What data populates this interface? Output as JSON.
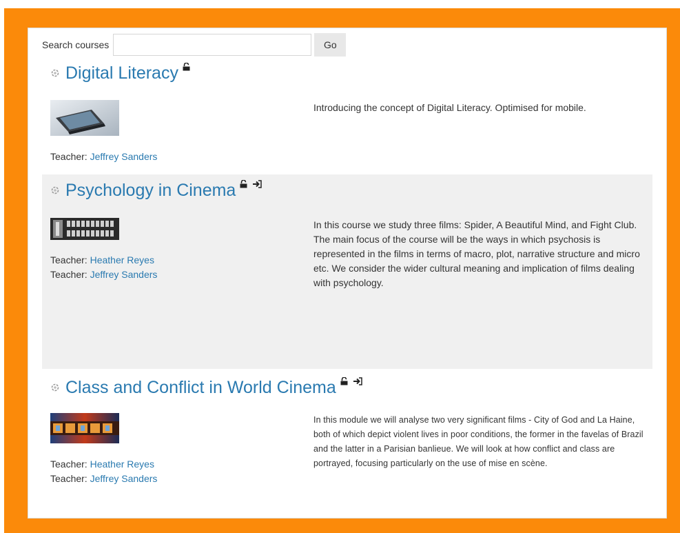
{
  "search": {
    "label": "Search courses",
    "value": "",
    "placeholder": "",
    "button_label": "Go"
  },
  "courses": [
    {
      "title": "Digital Literacy",
      "icons": [
        "lock-open-icon"
      ],
      "summary": "Introducing the concept of Digital Literacy. Optimised for mobile.",
      "teachers": [
        {
          "prefix": "Teacher:",
          "name": "Jeffrey Sanders"
        }
      ]
    },
    {
      "title": "Psychology in Cinema",
      "icons": [
        "lock-open-icon",
        "login-icon"
      ],
      "summary": "In this course we study three films: Spider, A Beautiful Mind, and Fight Club. The main focus of the course will be the ways in which psychosis is represented in the films in terms of macro, plot, narrative structure and micro etc. We consider the wider cultural meaning and implication of films dealing with psychology.",
      "teachers": [
        {
          "prefix": "Teacher:",
          "name": "Heather Reyes"
        },
        {
          "prefix": "Teacher:",
          "name": "Jeffrey Sanders"
        }
      ]
    },
    {
      "title": "Class and Conflict in World Cinema",
      "icons": [
        "lock-open-icon",
        "login-icon"
      ],
      "summary": "In this module we will analyse two very significant films - City of God and La Haine, both of which depict violent lives in poor conditions, the former in the favelas of Brazil and the latter in a Parisian banlieue. We will look at how conflict and class are portrayed, focusing particularly on the use of mise en scène.",
      "teachers": [
        {
          "prefix": "Teacher:",
          "name": "Heather Reyes"
        },
        {
          "prefix": "Teacher:",
          "name": "Jeffrey Sanders"
        }
      ]
    }
  ],
  "colors": {
    "frame": "#fb8a0a",
    "link": "#2a7ab0",
    "shaded_row": "#f0f0f0"
  }
}
